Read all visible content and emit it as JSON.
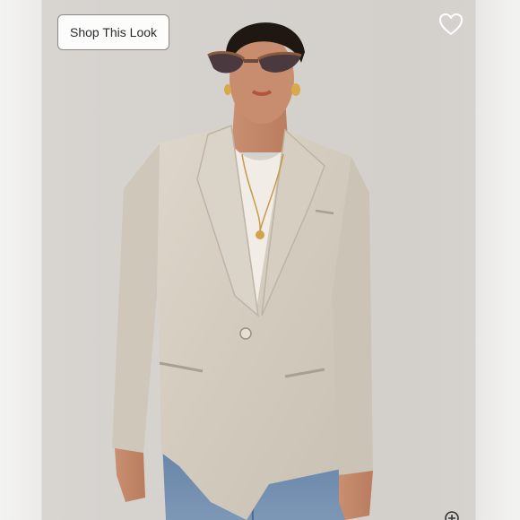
{
  "shop_look": {
    "label": "Shop This Look"
  },
  "favorite": {
    "icon": "heart-outline-icon"
  },
  "zoom": {
    "icon": "zoom-plus-icon"
  },
  "colors": {
    "backdrop": "#d4d1cd",
    "blazer": "#d3cbbd",
    "jeans": "#6f8bab",
    "button_border": "#8d8a86"
  }
}
